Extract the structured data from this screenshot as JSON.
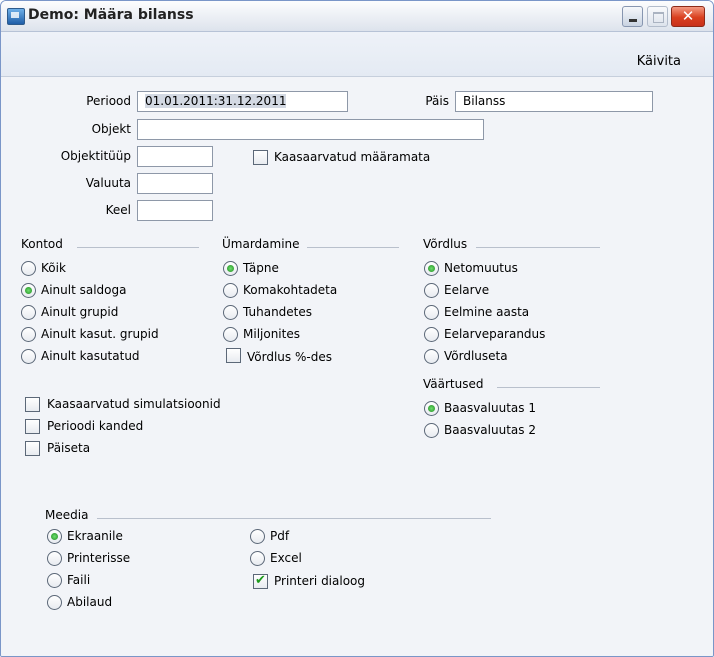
{
  "window": {
    "title": "Demo: Määra bilanss",
    "minimize_label": "_",
    "close_label": "✕"
  },
  "toolbar": {
    "run_label": "Käivita"
  },
  "fields": {
    "period": {
      "label": "Periood",
      "value": "01.01.2011:31.12.2011"
    },
    "header": {
      "label": "Päis",
      "value": "Bilanss"
    },
    "object": {
      "label": "Objekt",
      "value": ""
    },
    "object_type": {
      "label": "Objektitüüp",
      "value": ""
    },
    "currency": {
      "label": "Valuuta",
      "value": ""
    },
    "language": {
      "label": "Keel",
      "value": ""
    },
    "include_unassigned": {
      "label": "Kaasaarvatud määramata",
      "checked": false
    }
  },
  "accounts": {
    "title": "Kontod",
    "options": [
      {
        "label": "Kõik",
        "selected": false
      },
      {
        "label": "Ainult saldoga",
        "selected": true
      },
      {
        "label": "Ainult grupid",
        "selected": false
      },
      {
        "label": "Ainult kasut. grupid",
        "selected": false
      },
      {
        "label": "Ainult kasutatud",
        "selected": false
      }
    ]
  },
  "rounding": {
    "title": "Ümardamine",
    "options": [
      {
        "label": "Täpne",
        "selected": true
      },
      {
        "label": "Komakohtadeta",
        "selected": false
      },
      {
        "label": "Tuhandetes",
        "selected": false
      },
      {
        "label": "Miljonites",
        "selected": false
      }
    ],
    "percent_check": {
      "label": "Võrdlus %-des",
      "checked": false
    }
  },
  "comparison": {
    "title": "Võrdlus",
    "options": [
      {
        "label": "Netomuutus",
        "selected": true
      },
      {
        "label": "Eelarve",
        "selected": false
      },
      {
        "label": "Eelmine aasta",
        "selected": false
      },
      {
        "label": "Eelarveparandus",
        "selected": false
      },
      {
        "label": "Võrdluseta",
        "selected": false
      }
    ]
  },
  "values": {
    "title": "Väärtused",
    "options": [
      {
        "label": "Baasvaluutas 1",
        "selected": true
      },
      {
        "label": "Baasvaluutas 2",
        "selected": false
      }
    ]
  },
  "checks": [
    {
      "label": "Kaasaarvatud simulatsioonid",
      "checked": false
    },
    {
      "label": "Perioodi kanded",
      "checked": false
    },
    {
      "label": "Päiseta",
      "checked": false
    }
  ],
  "media": {
    "title": "Meedia",
    "left_options": [
      {
        "label": "Ekraanile",
        "selected": true
      },
      {
        "label": "Printerisse",
        "selected": false
      },
      {
        "label": "Faili",
        "selected": false
      },
      {
        "label": "Abilaud",
        "selected": false
      }
    ],
    "right_options": [
      {
        "label": "Pdf",
        "selected": false
      },
      {
        "label": "Excel",
        "selected": false
      }
    ],
    "printer_dialog": {
      "label": "Printeri dialoog",
      "checked": true
    }
  }
}
